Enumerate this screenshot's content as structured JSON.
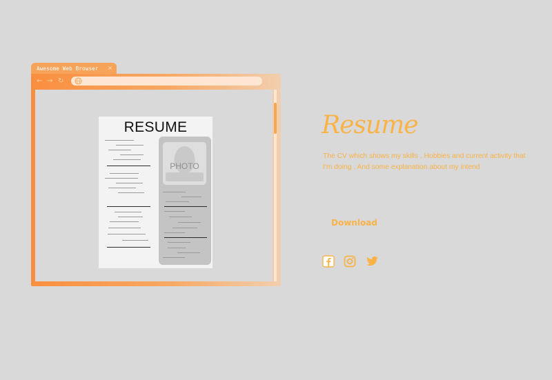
{
  "browser": {
    "tab_title": "Awesome Web Browser",
    "tab_close": "×",
    "nav_back": "←",
    "nav_forward": "→",
    "nav_reload": "↻",
    "resume": {
      "title": "RESUME",
      "photo_label": "PHOTO"
    }
  },
  "content": {
    "heading": "Resume",
    "description": "The CV which shows my skills , Hobbies and current activity that I'm doing . And some explanation about my intend",
    "download_label": "Download"
  },
  "social": [
    "facebook-icon",
    "instagram-icon",
    "twitter-icon"
  ],
  "colors": {
    "background": "#d9d9d9",
    "accent": "#f9b347",
    "browser_orange": "#f98e3f"
  }
}
